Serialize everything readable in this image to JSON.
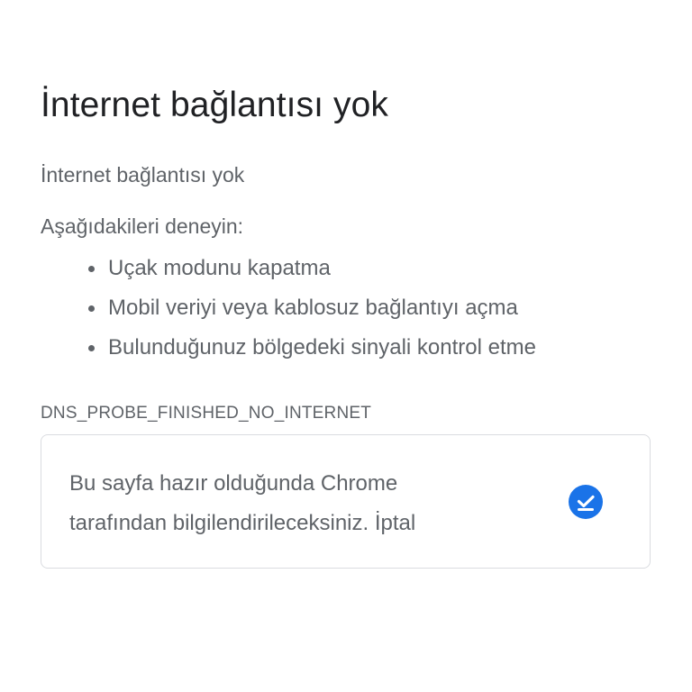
{
  "page": {
    "title": "İnternet bağlantısı yok",
    "subtitle": "İnternet bağlantısı yok",
    "try_heading": "Aşağıdakileri deneyin:",
    "suggestions": [
      "Uçak modunu kapatma",
      "Mobil veriyi veya kablosuz bağlantıyı açma",
      "Bulunduğunuz bölgedeki sinyali kontrol etme"
    ],
    "error_code": "DNS_PROBE_FINISHED_NO_INTERNET"
  },
  "notify": {
    "line1": "Bu sayfa hazır olduğunda Chrome",
    "line2": "tarafından bilgilendirileceksiniz. İptal",
    "icon": "download-check-icon",
    "icon_color": "#1a73e8"
  }
}
